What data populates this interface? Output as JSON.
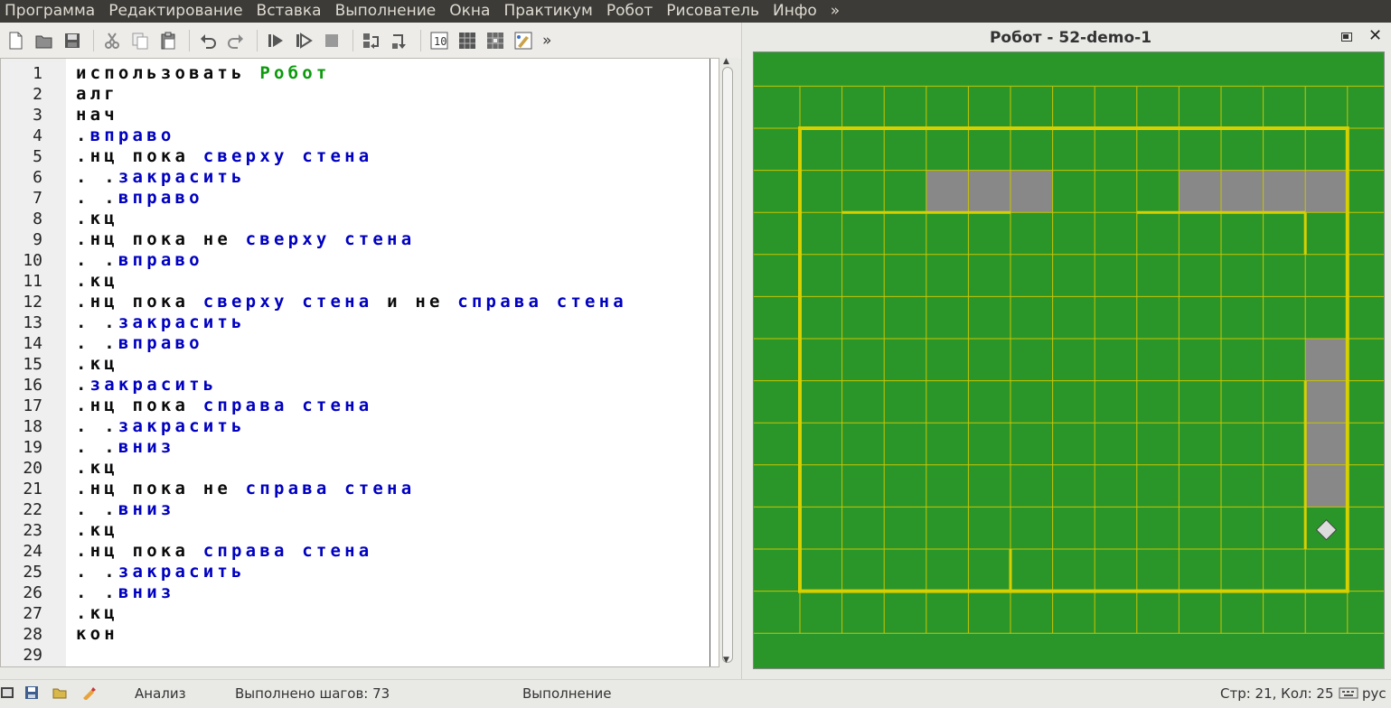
{
  "menu": [
    "Программа",
    "Редактирование",
    "Вставка",
    "Выполнение",
    "Окна",
    "Практикум",
    "Робот",
    "Рисователь",
    "Инфо",
    "»"
  ],
  "toolbar": {
    "more": "»",
    "icons": [
      "new-file-icon",
      "open-file-icon",
      "save-icon",
      "cut-icon",
      "copy-icon",
      "paste-icon",
      "undo-icon",
      "redo-icon",
      "run-icon",
      "step-run-icon",
      "stop-icon",
      "step-into-icon",
      "step-out-icon",
      "counter-icon",
      "grid-icon",
      "robot-field-icon",
      "painter-icon"
    ]
  },
  "editor": {
    "line_numbers": [
      "1",
      "2",
      "3",
      "4",
      "5",
      "6",
      "7",
      "8",
      "9",
      "10",
      "11",
      "12",
      "13",
      "14",
      "15",
      "16",
      "17",
      "18",
      "19",
      "20",
      "21",
      "22",
      "23",
      "24",
      "25",
      "26",
      "27",
      "28",
      "29"
    ],
    "lines": [
      [
        {
          "t": "использовать ",
          "c": "kw"
        },
        {
          "t": "Робот",
          "c": "act"
        }
      ],
      [
        {
          "t": "алг",
          "c": "kw"
        }
      ],
      [
        {
          "t": "нач",
          "c": "kw"
        }
      ],
      [
        {
          "t": ".",
          "c": "dot"
        },
        {
          "t": "вправо",
          "c": "fn"
        }
      ],
      [
        {
          "t": ".",
          "c": "dot"
        },
        {
          "t": "нц пока ",
          "c": "kw"
        },
        {
          "t": "сверху стена",
          "c": "fn"
        }
      ],
      [
        {
          "t": ". .",
          "c": "dot"
        },
        {
          "t": "закрасить",
          "c": "fn"
        }
      ],
      [
        {
          "t": ". .",
          "c": "dot"
        },
        {
          "t": "вправо",
          "c": "fn"
        }
      ],
      [
        {
          "t": ".",
          "c": "dot"
        },
        {
          "t": "кц",
          "c": "kw"
        }
      ],
      [
        {
          "t": ".",
          "c": "dot"
        },
        {
          "t": "нц пока не ",
          "c": "kw"
        },
        {
          "t": "сверху стена",
          "c": "fn"
        }
      ],
      [
        {
          "t": ". .",
          "c": "dot"
        },
        {
          "t": "вправо",
          "c": "fn"
        }
      ],
      [
        {
          "t": ".",
          "c": "dot"
        },
        {
          "t": "кц",
          "c": "kw"
        }
      ],
      [
        {
          "t": ".",
          "c": "dot"
        },
        {
          "t": "нц пока ",
          "c": "kw"
        },
        {
          "t": "сверху стена",
          "c": "fn"
        },
        {
          "t": " и не ",
          "c": "kw"
        },
        {
          "t": "справа стена",
          "c": "fn"
        }
      ],
      [
        {
          "t": ". .",
          "c": "dot"
        },
        {
          "t": "закрасить",
          "c": "fn"
        }
      ],
      [
        {
          "t": ". .",
          "c": "dot"
        },
        {
          "t": "вправо",
          "c": "fn"
        }
      ],
      [
        {
          "t": ".",
          "c": "dot"
        },
        {
          "t": "кц",
          "c": "kw"
        }
      ],
      [
        {
          "t": ".",
          "c": "dot"
        },
        {
          "t": "закрасить",
          "c": "fn"
        }
      ],
      [
        {
          "t": ".",
          "c": "dot"
        },
        {
          "t": "нц пока ",
          "c": "kw"
        },
        {
          "t": "справа стена",
          "c": "fn"
        }
      ],
      [
        {
          "t": ". .",
          "c": "dot"
        },
        {
          "t": "закрасить",
          "c": "fn"
        }
      ],
      [
        {
          "t": ". .",
          "c": "dot"
        },
        {
          "t": "вниз",
          "c": "fn"
        }
      ],
      [
        {
          "t": ".",
          "c": "dot"
        },
        {
          "t": "кц",
          "c": "kw"
        }
      ],
      [
        {
          "t": ".",
          "c": "dot"
        },
        {
          "t": "нц пока не ",
          "c": "kw"
        },
        {
          "t": "справа стена",
          "c": "fn"
        }
      ],
      [
        {
          "t": ". .",
          "c": "dot"
        },
        {
          "t": "вниз",
          "c": "fn"
        }
      ],
      [
        {
          "t": ".",
          "c": "dot"
        },
        {
          "t": "кц",
          "c": "kw"
        }
      ],
      [
        {
          "t": ".",
          "c": "dot"
        },
        {
          "t": "нц пока ",
          "c": "kw"
        },
        {
          "t": "справа стена",
          "c": "fn"
        }
      ],
      [
        {
          "t": ". .",
          "c": "dot"
        },
        {
          "t": "закрасить",
          "c": "fn"
        }
      ],
      [
        {
          "t": ". .",
          "c": "dot"
        },
        {
          "t": "вниз",
          "c": "fn"
        }
      ],
      [
        {
          "t": ".",
          "c": "dot"
        },
        {
          "t": "кц",
          "c": "kw"
        }
      ],
      [
        {
          "t": "кон",
          "c": "kw"
        }
      ],
      []
    ]
  },
  "robot": {
    "title": "Робот - 52-demo-1",
    "colors": {
      "field": "#2a962a",
      "grid": "#c9c400",
      "wall": "#d7cf00",
      "painted": "#888888",
      "robot": "#dcdcdc"
    },
    "grid_cols": 13,
    "grid_rows": 13,
    "painted_cells": [
      [
        3,
        1
      ],
      [
        4,
        1
      ],
      [
        5,
        1
      ],
      [
        9,
        1
      ],
      [
        10,
        1
      ],
      [
        11,
        1
      ],
      [
        12,
        1
      ],
      [
        12,
        5
      ],
      [
        12,
        6
      ],
      [
        12,
        7
      ],
      [
        12,
        8
      ]
    ],
    "robot_cell": [
      12,
      9
    ]
  },
  "status": {
    "mode": "Анализ",
    "steps": "Выполнено шагов: 73",
    "state": "Выполнение",
    "position": "Стр: 21, Кол: 25",
    "lang": "рус"
  }
}
